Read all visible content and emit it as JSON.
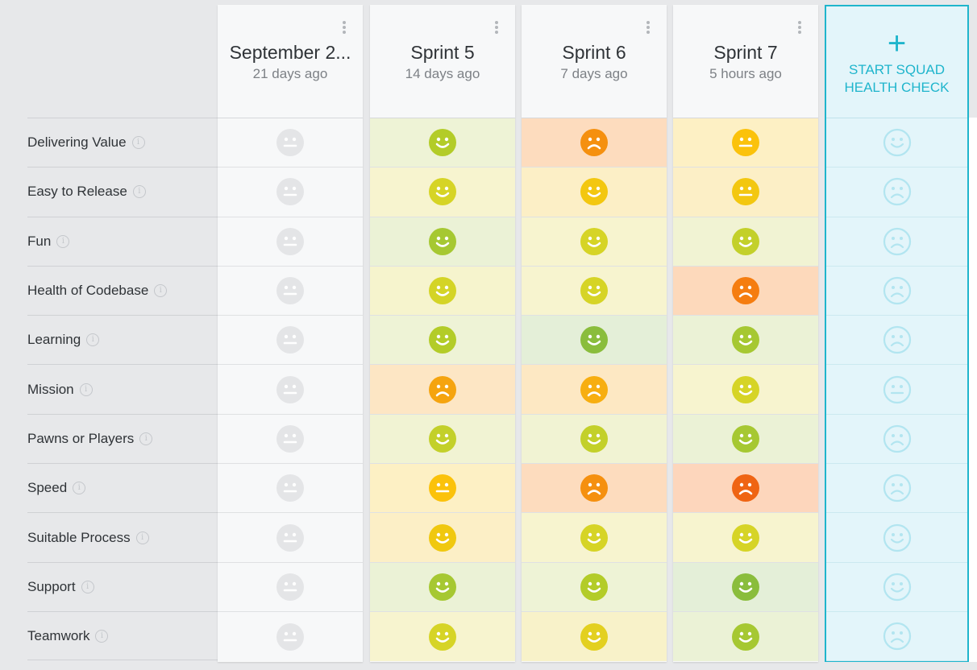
{
  "rows": [
    {
      "label": "Delivering Value"
    },
    {
      "label": "Easy to Release"
    },
    {
      "label": "Fun"
    },
    {
      "label": "Health of Codebase"
    },
    {
      "label": "Learning"
    },
    {
      "label": "Mission"
    },
    {
      "label": "Pawns or Players"
    },
    {
      "label": "Speed"
    },
    {
      "label": "Suitable Process"
    },
    {
      "label": "Support"
    },
    {
      "label": "Teamwork"
    }
  ],
  "info_icon_glyph": "i",
  "columns": [
    {
      "title": "September 2...",
      "subtitle": "21 days ago",
      "cells": [
        {
          "mood": "neutral",
          "face": "#e4e5e7",
          "bg": "#f7f8f9"
        },
        {
          "mood": "neutral",
          "face": "#e4e5e7",
          "bg": "#f7f8f9"
        },
        {
          "mood": "neutral",
          "face": "#e4e5e7",
          "bg": "#f7f8f9"
        },
        {
          "mood": "neutral",
          "face": "#e4e5e7",
          "bg": "#f7f8f9"
        },
        {
          "mood": "neutral",
          "face": "#e4e5e7",
          "bg": "#f7f8f9"
        },
        {
          "mood": "neutral",
          "face": "#e4e5e7",
          "bg": "#f7f8f9"
        },
        {
          "mood": "neutral",
          "face": "#e4e5e7",
          "bg": "#f7f8f9"
        },
        {
          "mood": "neutral",
          "face": "#e4e5e7",
          "bg": "#f7f8f9"
        },
        {
          "mood": "neutral",
          "face": "#e4e5e7",
          "bg": "#f7f8f9"
        },
        {
          "mood": "neutral",
          "face": "#e4e5e7",
          "bg": "#f7f8f9"
        },
        {
          "mood": "neutral",
          "face": "#e4e5e7",
          "bg": "#f7f8f9"
        }
      ]
    },
    {
      "title": "Sprint 5",
      "subtitle": "14 days ago",
      "cells": [
        {
          "mood": "happy",
          "face": "#b3cc28",
          "bg": "#eef3d6"
        },
        {
          "mood": "happy",
          "face": "#d6d426",
          "bg": "#f7f4cf"
        },
        {
          "mood": "happy",
          "face": "#a6c832",
          "bg": "#ebf2d6"
        },
        {
          "mood": "happy",
          "face": "#d4d426",
          "bg": "#f6f4cd"
        },
        {
          "mood": "happy",
          "face": "#b3cc28",
          "bg": "#eef3d6"
        },
        {
          "mood": "sad",
          "face": "#f5a40f",
          "bg": "#fde6c4"
        },
        {
          "mood": "happy",
          "face": "#c3d02a",
          "bg": "#f1f3d3"
        },
        {
          "mood": "neutral",
          "face": "#fbc20b",
          "bg": "#fdf0c4"
        },
        {
          "mood": "happy",
          "face": "#f0c80f",
          "bg": "#fcefc6"
        },
        {
          "mood": "happy",
          "face": "#a6c832",
          "bg": "#ebf2d6"
        },
        {
          "mood": "happy",
          "face": "#d6d426",
          "bg": "#f7f4cf"
        }
      ]
    },
    {
      "title": "Sprint 6",
      "subtitle": "7 days ago",
      "cells": [
        {
          "mood": "sad",
          "face": "#f5900f",
          "bg": "#fddcbe"
        },
        {
          "mood": "happy",
          "face": "#f3c710",
          "bg": "#fcefc6"
        },
        {
          "mood": "happy",
          "face": "#d6d426",
          "bg": "#f7f4cf"
        },
        {
          "mood": "happy",
          "face": "#d6d426",
          "bg": "#f7f4cf"
        },
        {
          "mood": "happy",
          "face": "#8abd3c",
          "bg": "#e4efd8"
        },
        {
          "mood": "sad",
          "face": "#f7ae10",
          "bg": "#fde8c3"
        },
        {
          "mood": "happy",
          "face": "#c3d02a",
          "bg": "#f1f3d3"
        },
        {
          "mood": "sad",
          "face": "#f5900f",
          "bg": "#fddcbe"
        },
        {
          "mood": "happy",
          "face": "#d6d426",
          "bg": "#f7f4cf"
        },
        {
          "mood": "happy",
          "face": "#b3cc28",
          "bg": "#eef3d6"
        },
        {
          "mood": "happy",
          "face": "#e3d020",
          "bg": "#f8f2c9"
        }
      ]
    },
    {
      "title": "Sprint 7",
      "subtitle": "5 hours ago",
      "cells": [
        {
          "mood": "neutral",
          "face": "#fbc20b",
          "bg": "#fdf0c4"
        },
        {
          "mood": "neutral",
          "face": "#f3c710",
          "bg": "#fcefc6"
        },
        {
          "mood": "happy",
          "face": "#c3d02a",
          "bg": "#f1f3d3"
        },
        {
          "mood": "sad",
          "face": "#f57d10",
          "bg": "#fdd9bb"
        },
        {
          "mood": "happy",
          "face": "#a6c832",
          "bg": "#ebf2d6"
        },
        {
          "mood": "happy",
          "face": "#d6d426",
          "bg": "#f7f4cf"
        },
        {
          "mood": "happy",
          "face": "#a6c832",
          "bg": "#ebf2d6"
        },
        {
          "mood": "sad",
          "face": "#ef6413",
          "bg": "#fdd6bc"
        },
        {
          "mood": "happy",
          "face": "#d6d426",
          "bg": "#f7f4cf"
        },
        {
          "mood": "happy",
          "face": "#8abd3c",
          "bg": "#e4efd8"
        },
        {
          "mood": "happy",
          "face": "#a6c832",
          "bg": "#ebf2d6"
        }
      ]
    }
  ],
  "start_column": {
    "label": "START SQUAD HEALTH CHECK",
    "plus": "+",
    "accent": "#1fb5cc",
    "face": "#b2e5f0",
    "moods": [
      "happy",
      "sad",
      "sad",
      "sad",
      "sad",
      "neutral",
      "sad",
      "sad",
      "happy",
      "happy",
      "sad"
    ]
  }
}
